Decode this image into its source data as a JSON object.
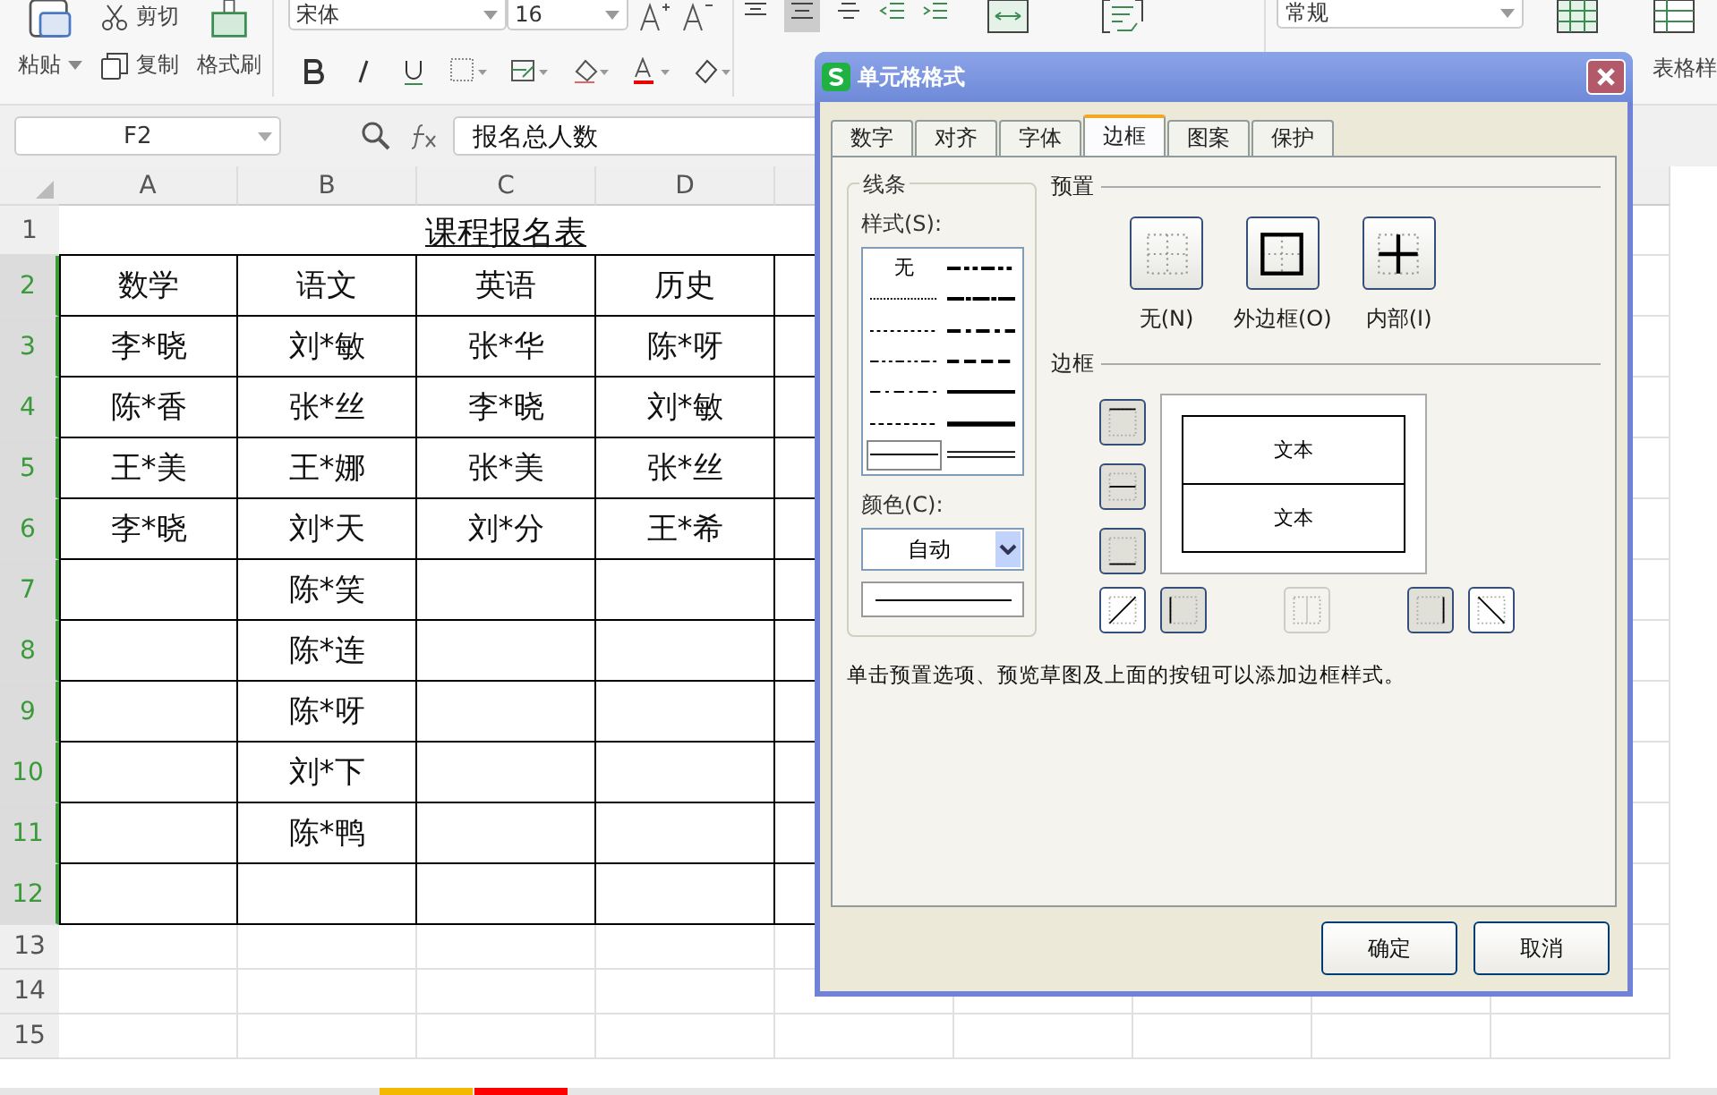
{
  "ribbon": {
    "paste": "粘贴",
    "cut": "剪切",
    "copy": "复制",
    "format_painter": "格式刷",
    "font_name": "宋体",
    "font_size": "16",
    "number_format": "常规",
    "table_style": "表格样"
  },
  "formula_bar": {
    "cell_name": "F2",
    "formula": "报名总人数"
  },
  "sheet": {
    "columns": [
      "A",
      "B",
      "C",
      "D"
    ],
    "title": "课程报名表",
    "rows": [
      {
        "number": "1",
        "selected": false,
        "bordered": false,
        "cells": {}
      },
      {
        "number": "2",
        "selected": true,
        "bordered": true,
        "cells": {
          "A": "数学",
          "B": "语文",
          "C": "英语",
          "D": "历史"
        }
      },
      {
        "number": "3",
        "selected": true,
        "bordered": true,
        "cells": {
          "A": "李*晓",
          "B": "刘*敏",
          "C": "张*华",
          "D": "陈*呀"
        }
      },
      {
        "number": "4",
        "selected": true,
        "bordered": true,
        "cells": {
          "A": "陈*香",
          "B": "张*丝",
          "C": "李*晓",
          "D": "刘*敏"
        }
      },
      {
        "number": "5",
        "selected": true,
        "bordered": true,
        "cells": {
          "A": "王*美",
          "B": "王*娜",
          "C": "张*美",
          "D": "张*丝"
        }
      },
      {
        "number": "6",
        "selected": true,
        "bordered": true,
        "cells": {
          "A": "李*晓",
          "B": "刘*天",
          "C": "刘*分",
          "D": "王*希"
        }
      },
      {
        "number": "7",
        "selected": true,
        "bordered": true,
        "cells": {
          "B": "陈*笑"
        }
      },
      {
        "number": "8",
        "selected": true,
        "bordered": true,
        "cells": {
          "B": "陈*连"
        }
      },
      {
        "number": "9",
        "selected": true,
        "bordered": true,
        "cells": {
          "B": "陈*呀"
        }
      },
      {
        "number": "10",
        "selected": true,
        "bordered": true,
        "cells": {
          "B": "刘*下"
        }
      },
      {
        "number": "11",
        "selected": true,
        "bordered": true,
        "cells": {
          "B": "陈*鸭"
        }
      },
      {
        "number": "12",
        "selected": true,
        "bordered": true,
        "cells": {}
      },
      {
        "number": "13",
        "selected": false,
        "bordered": false,
        "cells": {}
      },
      {
        "number": "14",
        "selected": false,
        "bordered": false,
        "cells": {}
      },
      {
        "number": "15",
        "selected": false,
        "bordered": false,
        "cells": {}
      }
    ]
  },
  "sheet_tabs": [
    {
      "color": "#f5b800"
    },
    {
      "color": "#ff0000"
    }
  ],
  "dialog": {
    "title": "单元格格式",
    "tabs": [
      {
        "label": "数字",
        "selected": false
      },
      {
        "label": "对齐",
        "selected": false
      },
      {
        "label": "字体",
        "selected": false
      },
      {
        "label": "边框",
        "selected": true
      },
      {
        "label": "图案",
        "selected": false
      },
      {
        "label": "保护",
        "selected": false
      }
    ],
    "line_group": "线条",
    "style_label": "样式(S):",
    "line_styles": [
      {
        "kind": "none",
        "label": "无",
        "selected": false
      },
      {
        "kind": "hair",
        "selected": false
      },
      {
        "kind": "dotted",
        "selected": false
      },
      {
        "kind": "dashdotdot",
        "selected": false
      },
      {
        "kind": "dashdot",
        "selected": false
      },
      {
        "kind": "dashed",
        "selected": false
      },
      {
        "kind": "thin",
        "selected": true
      },
      {
        "kind": "mediumdashdotdot",
        "selected": false
      },
      {
        "kind": "slantdashdot",
        "selected": false
      },
      {
        "kind": "mediumdashdot",
        "selected": false
      },
      {
        "kind": "mediumdashed",
        "selected": false
      },
      {
        "kind": "medium",
        "selected": false
      },
      {
        "kind": "thick",
        "selected": false
      },
      {
        "kind": "double",
        "selected": false
      }
    ],
    "color_label": "颜色(C):",
    "color_value": "自动",
    "presets_label": "预置",
    "presets": [
      {
        "kind": "none",
        "label": "无(N)"
      },
      {
        "kind": "outline",
        "label": "外边框(O)"
      },
      {
        "kind": "inside",
        "label": "内部(I)"
      }
    ],
    "border_label": "边框",
    "preview_texts": [
      "文本",
      "文本"
    ],
    "side_buttons": [
      {
        "kind": "top",
        "pressed": true,
        "disabled": false
      },
      {
        "kind": "middle",
        "pressed": true,
        "disabled": false
      },
      {
        "kind": "bottom",
        "pressed": true,
        "disabled": false
      }
    ],
    "bottom_buttons": [
      {
        "kind": "diagup",
        "pressed": false,
        "disabled": false
      },
      {
        "kind": "left",
        "pressed": true,
        "disabled": false
      },
      {
        "kind": "center",
        "pressed": false,
        "disabled": true
      },
      {
        "kind": "right",
        "pressed": true,
        "disabled": false
      },
      {
        "kind": "diagdown",
        "pressed": false,
        "disabled": false
      }
    ],
    "hint": "单击预置选项、预览草图及上面的按钮可以添加边框样式。",
    "buttons": [
      "确定",
      "取消"
    ]
  }
}
